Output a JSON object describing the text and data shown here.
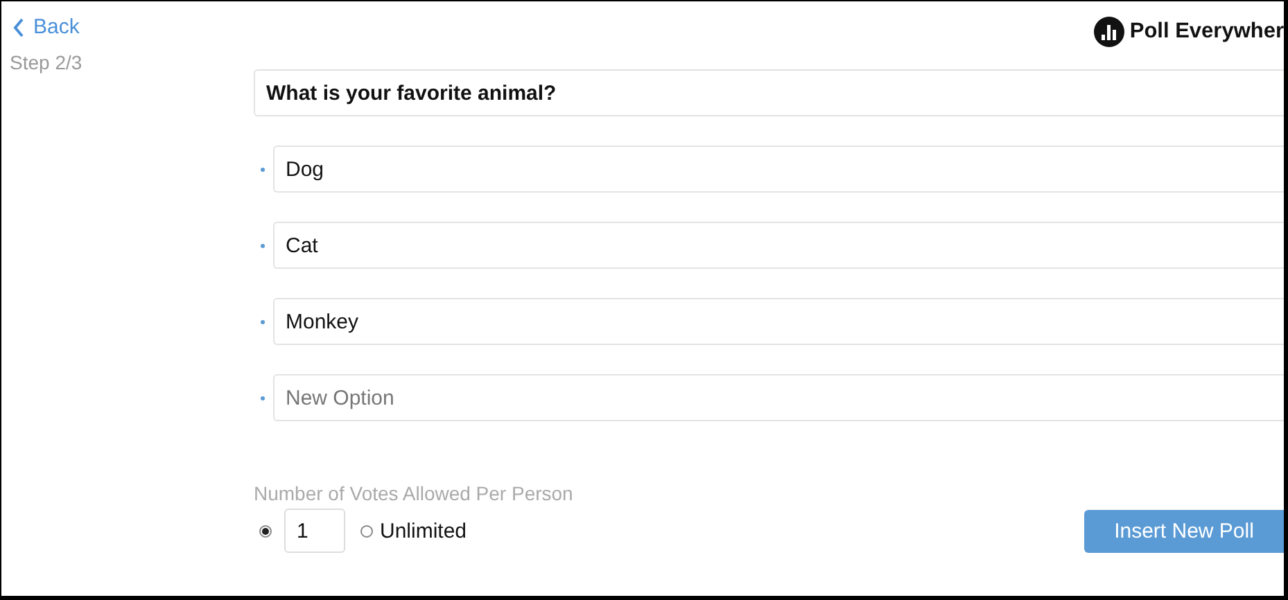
{
  "back": {
    "label": "Back"
  },
  "step": "Step 2/3",
  "logo": {
    "text": "Poll Everywher"
  },
  "question": {
    "value": "What is your favorite animal?"
  },
  "options": [
    {
      "value": "Dog"
    },
    {
      "value": "Cat"
    },
    {
      "value": "Monkey"
    },
    {
      "placeholder": "New Option"
    }
  ],
  "votes": {
    "label": "Number of Votes Allowed Per Person",
    "choices": [
      {
        "kind": "number",
        "value": "1",
        "selected": true
      },
      {
        "kind": "unlimited",
        "label": "Unlimited",
        "selected": false
      }
    ]
  },
  "insert_button": "Insert New Poll"
}
